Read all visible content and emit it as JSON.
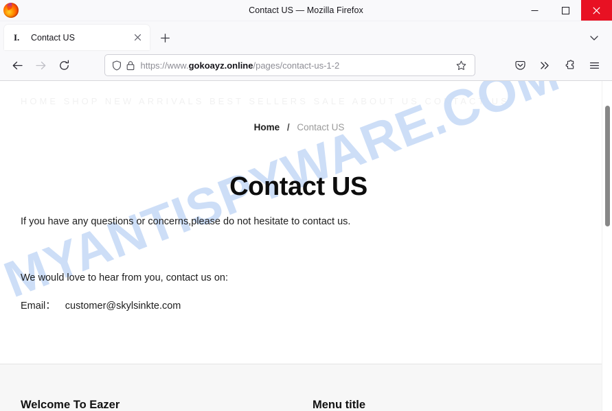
{
  "window": {
    "title": "Contact US — Mozilla Firefox",
    "minimize_label": "minimize-icon",
    "maximize_label": "maximize-icon",
    "close_label": "close-icon",
    "app_icon": "firefox-logo"
  },
  "tabs": {
    "active": {
      "favicon_text": "I.",
      "title": "Contact US",
      "close_label": "×"
    },
    "new_tab_label": "+",
    "list_all_label": "chevron-down-icon"
  },
  "toolbar": {
    "back_label": "back-arrow-icon",
    "forward_label": "forward-arrow-icon",
    "reload_label": "reload-icon",
    "shield_label": "tracking-protection-shield-icon",
    "lock_label": "padlock-icon",
    "bookmark_label": "star-icon",
    "pocket_label": "pocket-icon",
    "overflow_label": "double-chevron-icon",
    "extensions_label": "extensions-puzzle-icon",
    "menu_label": "hamburger-menu-icon"
  },
  "urlbar": {
    "scheme": "https://www.",
    "host": "gokoayz.online",
    "path": "/pages/contact-us-1-2",
    "full_url": "https://www.gokoayz.online/pages/contact-us-1-2"
  },
  "page": {
    "ghost_nav_text": "HOME    SHOP    NEW ARRIVALS    BEST SELLERS    SALE    ABOUT US    CONTACT US",
    "watermark": "MYANTISPYWARE.COM",
    "breadcrumb": {
      "home": "Home",
      "separator": "/",
      "current": "Contact US"
    },
    "title": "Contact US",
    "paragraphs": {
      "questions": "If you have any questions or concerns,please do not hesitate to contact us.",
      "love": "We would love to hear from you, contact us on:",
      "email_label": "Email：",
      "email_value": "customer@skylsinkte.com"
    },
    "footer": {
      "column_1_title": "Welcome To Eazer",
      "column_2_title": "Menu title"
    },
    "scrollbar_label": "page-vertical-scrollbar"
  },
  "colors": {
    "chrome_bg": "#f9f9fb",
    "close_button": "#e81123",
    "watermark": "#c9dcf7",
    "footer_bg": "#f7f7f7",
    "url_host": "#15141a"
  }
}
